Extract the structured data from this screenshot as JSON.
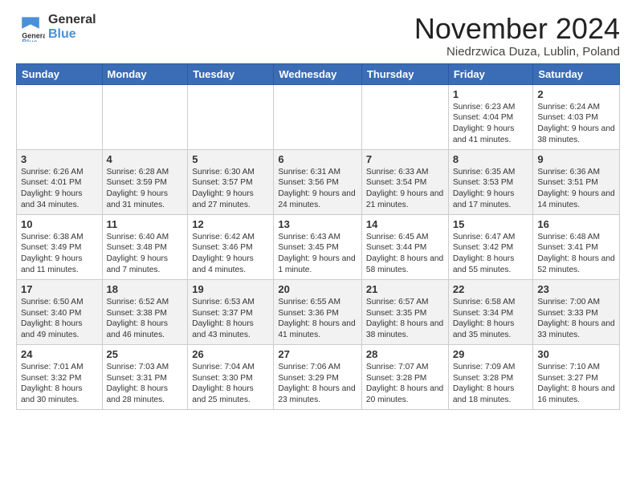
{
  "logo": {
    "line1": "General",
    "line2": "Blue"
  },
  "title": "November 2024",
  "location": "Niedrzwica Duza, Lublin, Poland",
  "weekdays": [
    "Sunday",
    "Monday",
    "Tuesday",
    "Wednesday",
    "Thursday",
    "Friday",
    "Saturday"
  ],
  "weeks": [
    [
      {
        "day": "",
        "info": ""
      },
      {
        "day": "",
        "info": ""
      },
      {
        "day": "",
        "info": ""
      },
      {
        "day": "",
        "info": ""
      },
      {
        "day": "",
        "info": ""
      },
      {
        "day": "1",
        "info": "Sunrise: 6:23 AM\nSunset: 4:04 PM\nDaylight: 9 hours and 41 minutes."
      },
      {
        "day": "2",
        "info": "Sunrise: 6:24 AM\nSunset: 4:03 PM\nDaylight: 9 hours and 38 minutes."
      }
    ],
    [
      {
        "day": "3",
        "info": "Sunrise: 6:26 AM\nSunset: 4:01 PM\nDaylight: 9 hours and 34 minutes."
      },
      {
        "day": "4",
        "info": "Sunrise: 6:28 AM\nSunset: 3:59 PM\nDaylight: 9 hours and 31 minutes."
      },
      {
        "day": "5",
        "info": "Sunrise: 6:30 AM\nSunset: 3:57 PM\nDaylight: 9 hours and 27 minutes."
      },
      {
        "day": "6",
        "info": "Sunrise: 6:31 AM\nSunset: 3:56 PM\nDaylight: 9 hours and 24 minutes."
      },
      {
        "day": "7",
        "info": "Sunrise: 6:33 AM\nSunset: 3:54 PM\nDaylight: 9 hours and 21 minutes."
      },
      {
        "day": "8",
        "info": "Sunrise: 6:35 AM\nSunset: 3:53 PM\nDaylight: 9 hours and 17 minutes."
      },
      {
        "day": "9",
        "info": "Sunrise: 6:36 AM\nSunset: 3:51 PM\nDaylight: 9 hours and 14 minutes."
      }
    ],
    [
      {
        "day": "10",
        "info": "Sunrise: 6:38 AM\nSunset: 3:49 PM\nDaylight: 9 hours and 11 minutes."
      },
      {
        "day": "11",
        "info": "Sunrise: 6:40 AM\nSunset: 3:48 PM\nDaylight: 9 hours and 7 minutes."
      },
      {
        "day": "12",
        "info": "Sunrise: 6:42 AM\nSunset: 3:46 PM\nDaylight: 9 hours and 4 minutes."
      },
      {
        "day": "13",
        "info": "Sunrise: 6:43 AM\nSunset: 3:45 PM\nDaylight: 9 hours and 1 minute."
      },
      {
        "day": "14",
        "info": "Sunrise: 6:45 AM\nSunset: 3:44 PM\nDaylight: 8 hours and 58 minutes."
      },
      {
        "day": "15",
        "info": "Sunrise: 6:47 AM\nSunset: 3:42 PM\nDaylight: 8 hours and 55 minutes."
      },
      {
        "day": "16",
        "info": "Sunrise: 6:48 AM\nSunset: 3:41 PM\nDaylight: 8 hours and 52 minutes."
      }
    ],
    [
      {
        "day": "17",
        "info": "Sunrise: 6:50 AM\nSunset: 3:40 PM\nDaylight: 8 hours and 49 minutes."
      },
      {
        "day": "18",
        "info": "Sunrise: 6:52 AM\nSunset: 3:38 PM\nDaylight: 8 hours and 46 minutes."
      },
      {
        "day": "19",
        "info": "Sunrise: 6:53 AM\nSunset: 3:37 PM\nDaylight: 8 hours and 43 minutes."
      },
      {
        "day": "20",
        "info": "Sunrise: 6:55 AM\nSunset: 3:36 PM\nDaylight: 8 hours and 41 minutes."
      },
      {
        "day": "21",
        "info": "Sunrise: 6:57 AM\nSunset: 3:35 PM\nDaylight: 8 hours and 38 minutes."
      },
      {
        "day": "22",
        "info": "Sunrise: 6:58 AM\nSunset: 3:34 PM\nDaylight: 8 hours and 35 minutes."
      },
      {
        "day": "23",
        "info": "Sunrise: 7:00 AM\nSunset: 3:33 PM\nDaylight: 8 hours and 33 minutes."
      }
    ],
    [
      {
        "day": "24",
        "info": "Sunrise: 7:01 AM\nSunset: 3:32 PM\nDaylight: 8 hours and 30 minutes."
      },
      {
        "day": "25",
        "info": "Sunrise: 7:03 AM\nSunset: 3:31 PM\nDaylight: 8 hours and 28 minutes."
      },
      {
        "day": "26",
        "info": "Sunrise: 7:04 AM\nSunset: 3:30 PM\nDaylight: 8 hours and 25 minutes."
      },
      {
        "day": "27",
        "info": "Sunrise: 7:06 AM\nSunset: 3:29 PM\nDaylight: 8 hours and 23 minutes."
      },
      {
        "day": "28",
        "info": "Sunrise: 7:07 AM\nSunset: 3:28 PM\nDaylight: 8 hours and 20 minutes."
      },
      {
        "day": "29",
        "info": "Sunrise: 7:09 AM\nSunset: 3:28 PM\nDaylight: 8 hours and 18 minutes."
      },
      {
        "day": "30",
        "info": "Sunrise: 7:10 AM\nSunset: 3:27 PM\nDaylight: 8 hours and 16 minutes."
      }
    ]
  ]
}
